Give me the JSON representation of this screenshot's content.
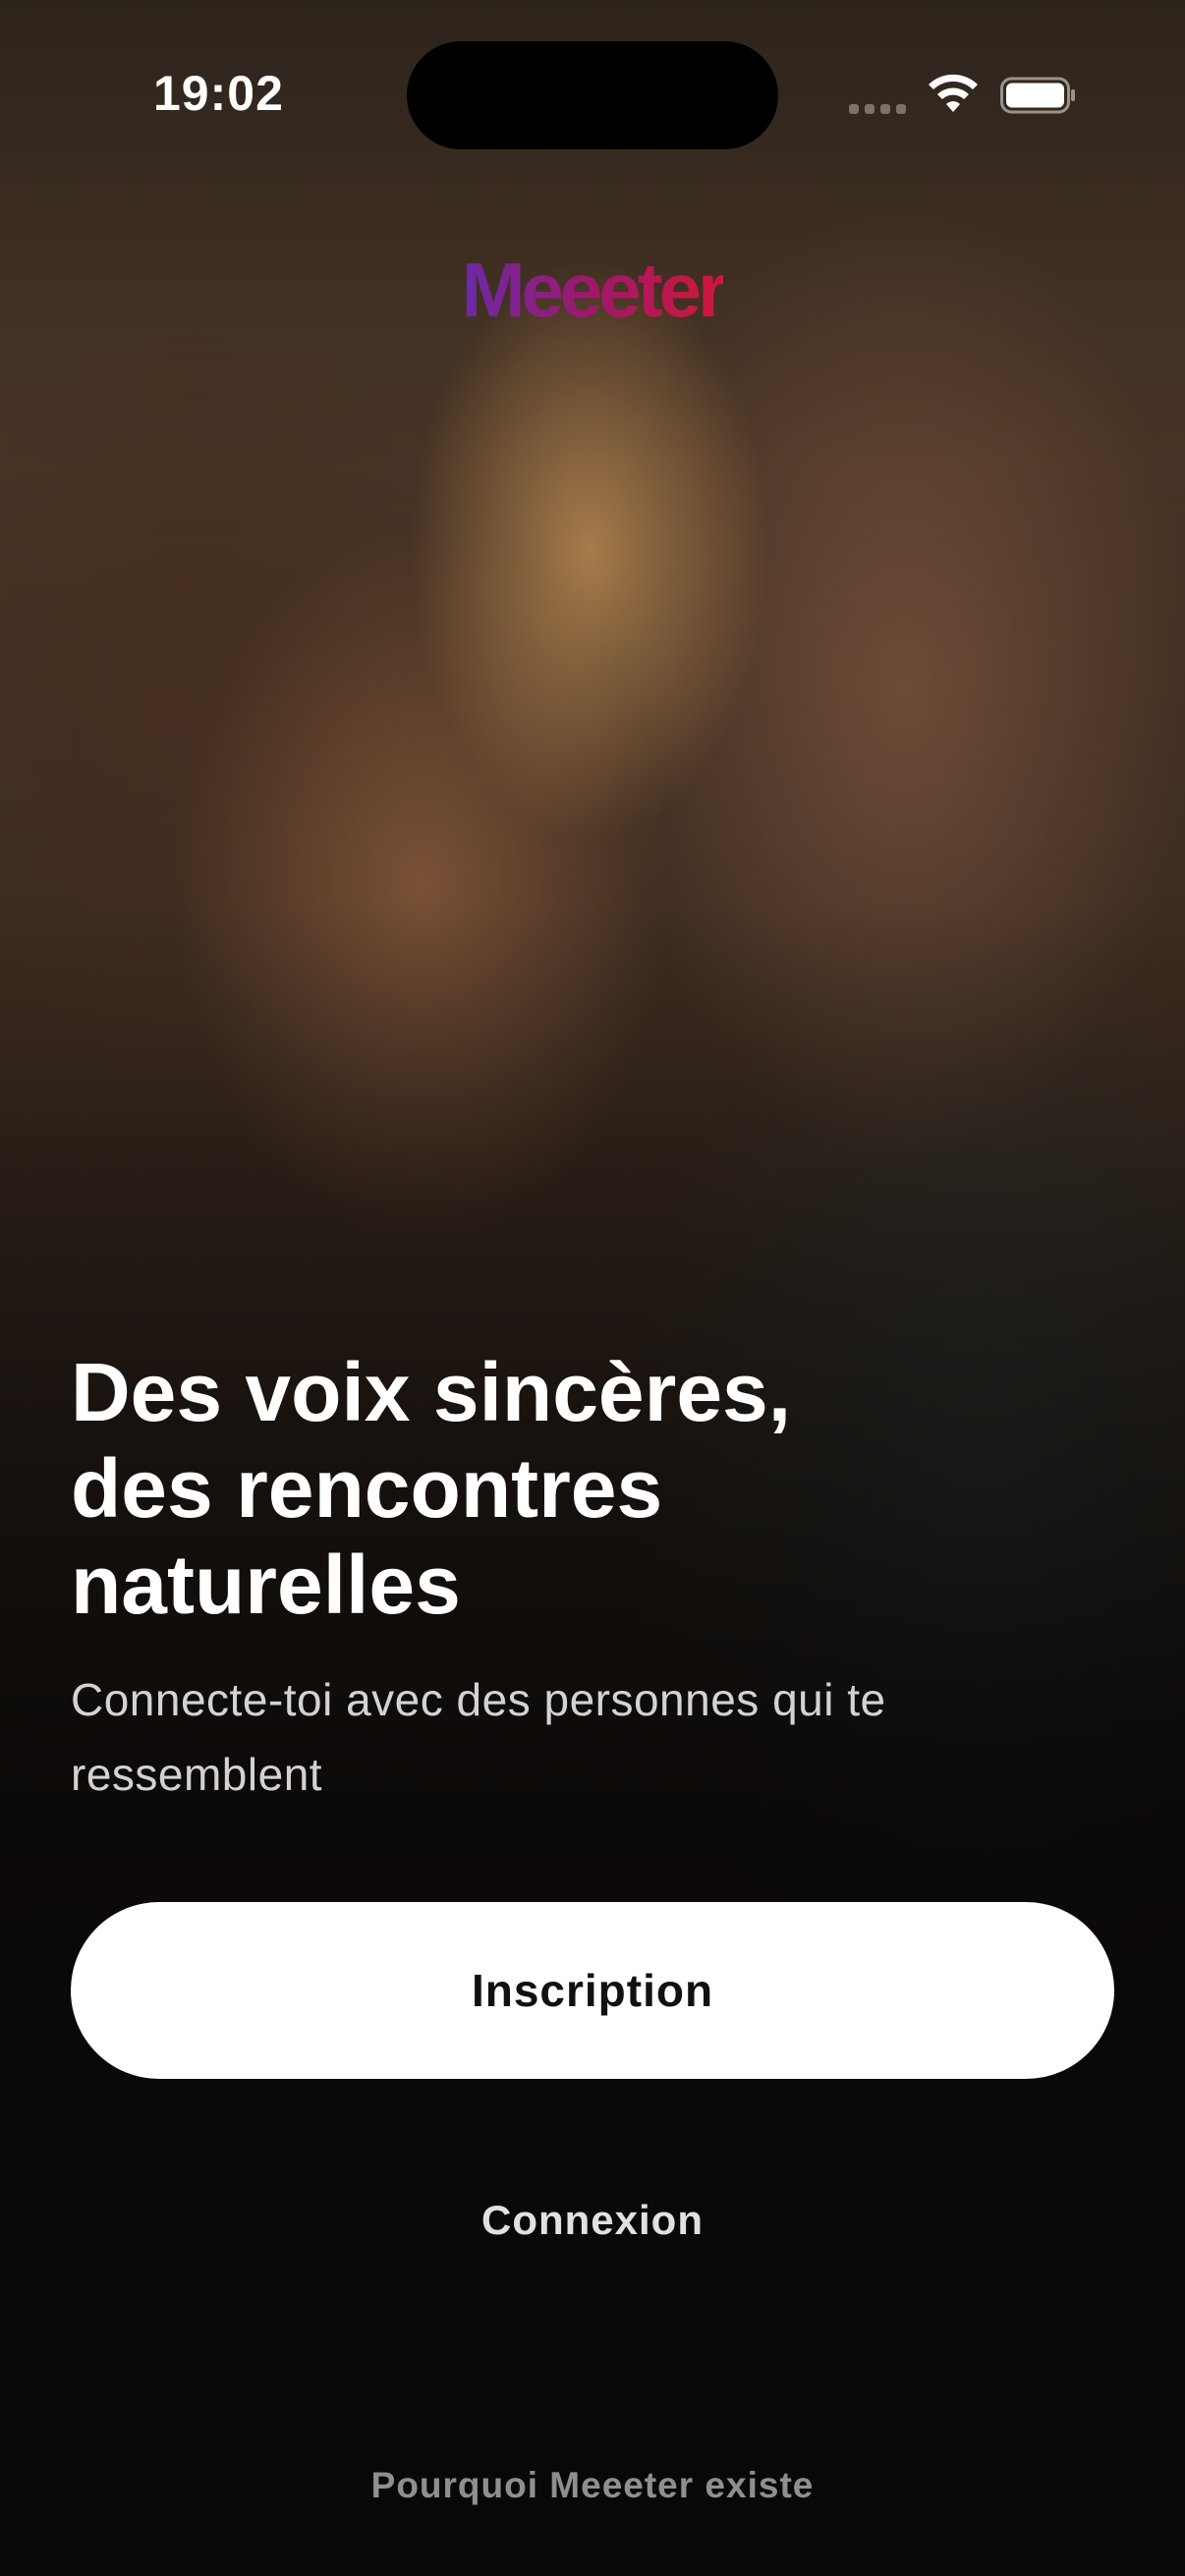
{
  "status_bar": {
    "time": "19:02"
  },
  "brand": {
    "logo_text": "Meeeter",
    "gradient_colors": [
      "#6b2aa8",
      "#a0186a",
      "#d0183a"
    ]
  },
  "hero": {
    "background_image": "couple-photo",
    "headline": "Des voix sincères,\ndes rencontres\nnaturelles",
    "subtitle": "Connecte-toi avec des personnes qui te ressemblent"
  },
  "actions": {
    "signup_label": "Inscription",
    "login_label": "Connexion",
    "why_label": "Pourquoi Meeeter existe"
  },
  "colors": {
    "primary_button_bg": "#ffffff",
    "primary_button_text": "#111111",
    "text": "#ffffff"
  }
}
